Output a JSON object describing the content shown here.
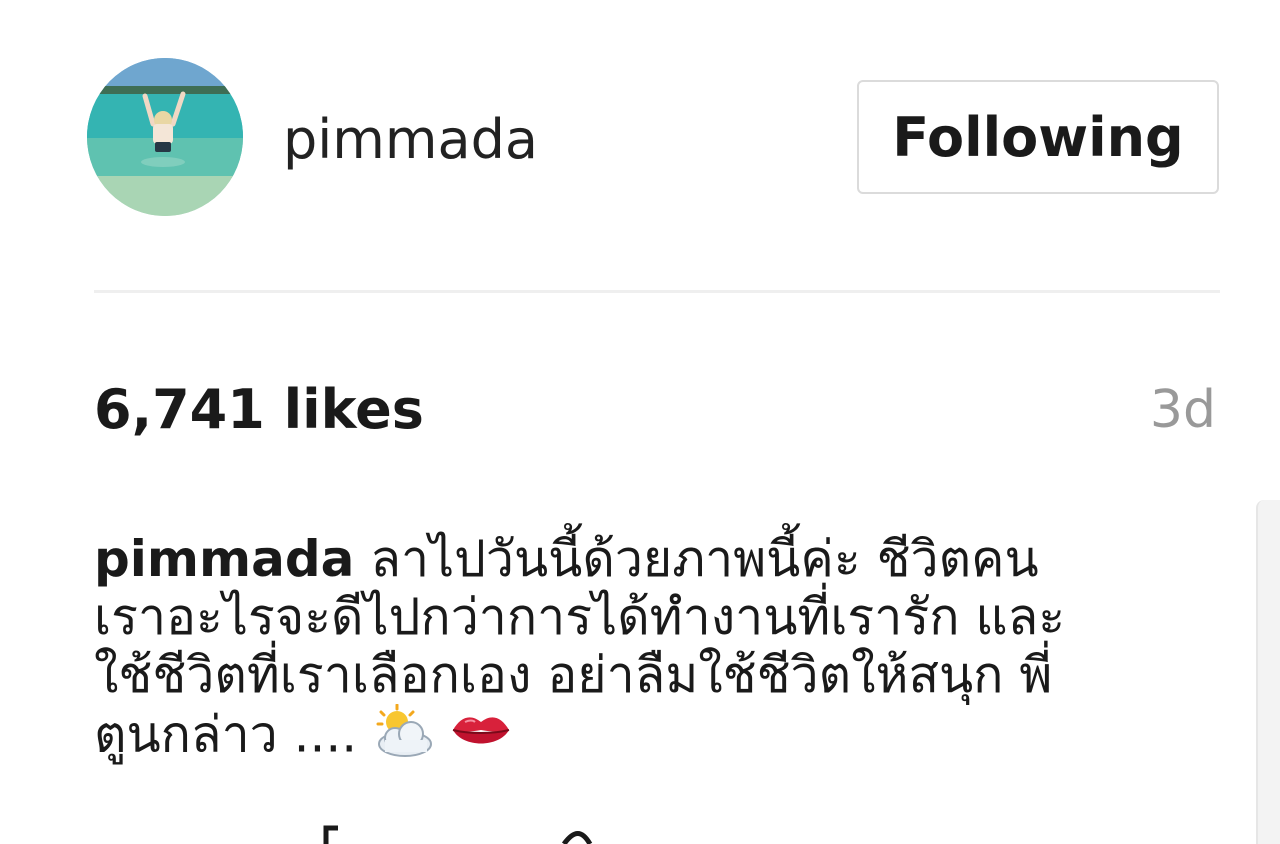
{
  "header": {
    "username": "pimmada",
    "follow_button_label": "Following"
  },
  "post": {
    "likes": "6,741 likes",
    "timestamp": "3d"
  },
  "caption": {
    "username": "pimmada",
    "lines": [
      "ลาไปวันนี้ด้วยภาพนี้ค่ะ ชีวิตคน",
      "เราอะไรจะดีไปกว่าการได้ทำงานที่เรารัก และ",
      "ใช้ชีวิตที่เราเลือกเอง อย่าลืมใช้ชีวิตให้สนุก พี่",
      "ตูนกล่าว ...."
    ],
    "emojis": [
      "sun-behind-cloud-icon",
      "kiss-mark-icon"
    ]
  },
  "colors": {
    "button_border": "#dbdbdb",
    "divider": "#efefef",
    "timestamp": "#999999",
    "text": "#1a1a1a"
  }
}
